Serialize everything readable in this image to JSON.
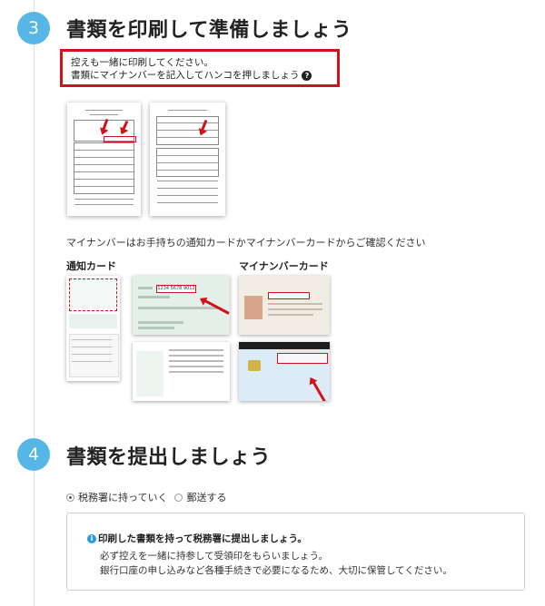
{
  "step3": {
    "number": "3",
    "title": "書類を印刷して準備しましょう",
    "notice": {
      "line1": "控えも一緒に印刷してください。",
      "line2": "書類にマイナンバーを記入してハンコを押しましょう",
      "help_icon": "?"
    },
    "documents": [
      {
        "name": "application-form-sample-1"
      },
      {
        "name": "application-form-sample-2"
      }
    ],
    "caption": "マイナンバーはお手持ちの通知カードかマイナンバーカードからご確認ください",
    "notification_card": {
      "label": "通知カード",
      "number_sample": "1234 5678 9012"
    },
    "mynumber_card": {
      "label": "マイナンバーカード"
    }
  },
  "step4": {
    "number": "4",
    "title": "書類を提出しましょう",
    "options": [
      {
        "label": "税務署に持っていく",
        "checked": true
      },
      {
        "label": "郵送する",
        "checked": false
      }
    ],
    "info": {
      "icon": "i",
      "heading": "印刷した書類を持って税務署に提出しましょう。",
      "line1": "必ず控えを一緒に持参して受領印をもらいましょう。",
      "line2": "銀行口座の申し込みなど各種手続きで必要になるため、大切に保管してください。"
    }
  },
  "colors": {
    "step_circle": "#56b6e6",
    "notice_border": "#d0131b",
    "arrow": "#d0131b",
    "info_icon": "#2a9ae0"
  }
}
